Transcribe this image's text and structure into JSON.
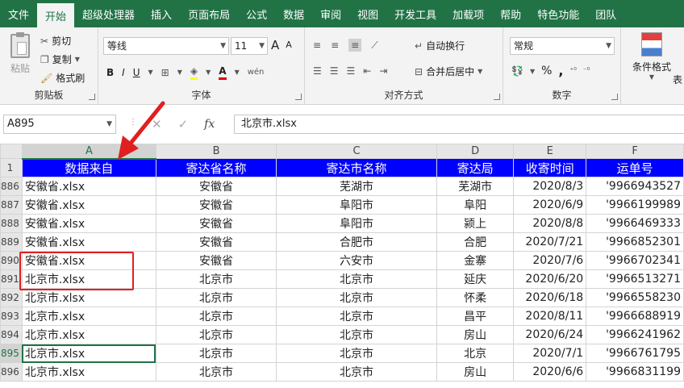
{
  "menu": [
    "文件",
    "开始",
    "超级处理器",
    "插入",
    "页面布局",
    "公式",
    "数据",
    "审阅",
    "视图",
    "开发工具",
    "加载项",
    "帮助",
    "特色功能",
    "团队"
  ],
  "active_menu_index": 1,
  "ribbon": {
    "clipboard": {
      "paste": "粘贴",
      "cut": "剪切",
      "copy": "复制",
      "format_painter": "格式刷",
      "label": "剪贴板"
    },
    "font": {
      "name": "等线",
      "size": "11",
      "bold": "B",
      "italic": "I",
      "underline": "U",
      "grow": "A",
      "shrink": "A",
      "label": "字体"
    },
    "alignment": {
      "wrap": "自动换行",
      "merge": "合并后居中",
      "label": "对齐方式"
    },
    "number": {
      "format": "常规",
      "percent": "%",
      "comma": ",",
      "label": "数字"
    },
    "styles": {
      "conditional": "条件格式",
      "table_partial": "表"
    }
  },
  "formula_bar": {
    "name_box": "A895",
    "fx": "fx",
    "value": "北京市.xlsx"
  },
  "grid": {
    "columns": [
      "A",
      "B",
      "C",
      "D",
      "E",
      "F"
    ],
    "selected_column": "A",
    "header_row_num": "1",
    "headers": [
      "数据来自",
      "寄达省名称",
      "寄达市名称",
      "寄达局",
      "收寄时间",
      "运单号"
    ],
    "rows": [
      {
        "num": "886",
        "cells": [
          "安徽省.xlsx",
          "安徽省",
          "芜湖市",
          "芜湖市",
          "2020/8/3",
          "'9966943527"
        ]
      },
      {
        "num": "887",
        "cells": [
          "安徽省.xlsx",
          "安徽省",
          "阜阳市",
          "阜阳",
          "2020/6/9",
          "'9966199989"
        ]
      },
      {
        "num": "888",
        "cells": [
          "安徽省.xlsx",
          "安徽省",
          "阜阳市",
          "颍上",
          "2020/8/8",
          "'9966469333"
        ]
      },
      {
        "num": "889",
        "cells": [
          "安徽省.xlsx",
          "安徽省",
          "合肥市",
          "合肥",
          "2020/7/21",
          "'9966852301"
        ]
      },
      {
        "num": "890",
        "cells": [
          "安徽省.xlsx",
          "安徽省",
          "六安市",
          "金寨",
          "2020/7/6",
          "'9966702341"
        ]
      },
      {
        "num": "891",
        "cells": [
          "北京市.xlsx",
          "北京市",
          "北京市",
          "延庆",
          "2020/6/20",
          "'9966513271"
        ]
      },
      {
        "num": "892",
        "cells": [
          "北京市.xlsx",
          "北京市",
          "北京市",
          "怀柔",
          "2020/6/18",
          "'9966558230"
        ]
      },
      {
        "num": "893",
        "cells": [
          "北京市.xlsx",
          "北京市",
          "北京市",
          "昌平",
          "2020/8/11",
          "'9966688919"
        ]
      },
      {
        "num": "894",
        "cells": [
          "北京市.xlsx",
          "北京市",
          "北京市",
          "房山",
          "2020/6/24",
          "'9966241962"
        ]
      },
      {
        "num": "895",
        "cells": [
          "北京市.xlsx",
          "北京市",
          "北京市",
          "北京",
          "2020/7/1",
          "'9966761795"
        ]
      },
      {
        "num": "896",
        "cells": [
          "北京市.xlsx",
          "北京市",
          "北京市",
          "房山",
          "2020/6/6",
          "'9966831199"
        ]
      }
    ],
    "active_row": "895"
  },
  "colors": {
    "excel_green": "#217346",
    "header_blue": "#0000ff",
    "annotation_red": "#e02020"
  }
}
